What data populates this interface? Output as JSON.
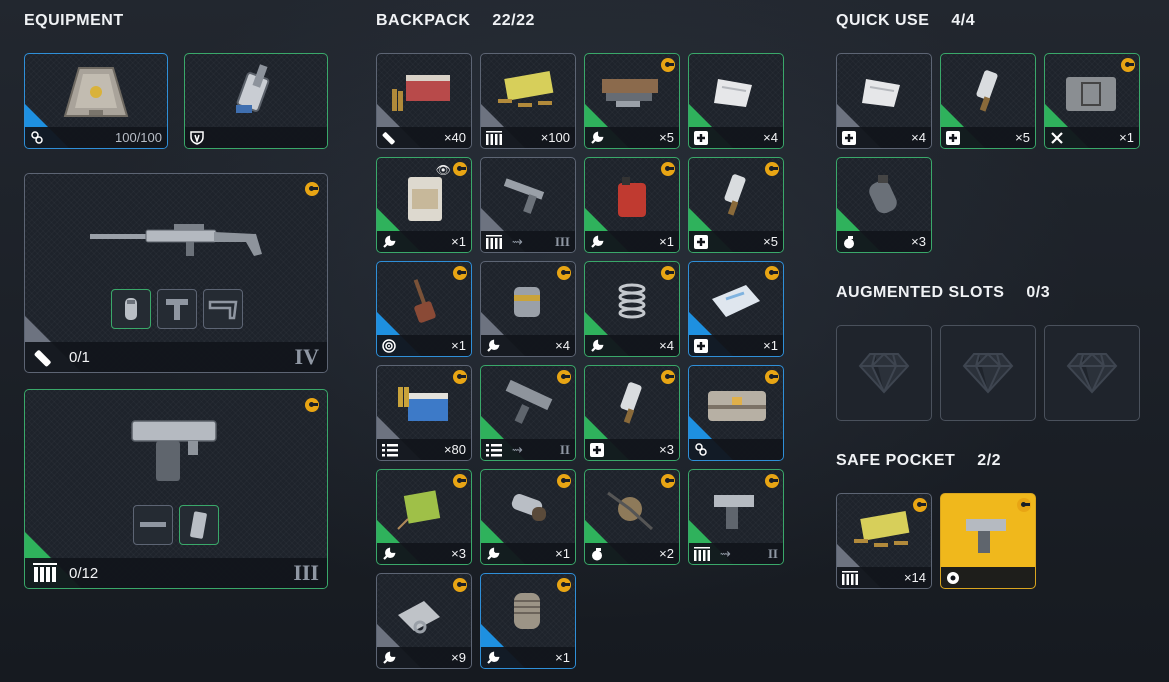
{
  "equipment": {
    "title": "EQUIPMENT",
    "slots": [
      {
        "icon": "backpack-icon",
        "amount": "100/100",
        "rarity": "blue"
      },
      {
        "icon": "shield-gadget-icon",
        "amount": "",
        "rarity": "green"
      }
    ],
    "primary_weapon": {
      "ammo": "0/1",
      "tier": "IV",
      "attachment_icons": [
        "grenade-attachment-icon",
        "stock-attachment-icon",
        "sight-attachment-icon"
      ]
    },
    "sidearm": {
      "ammo": "0/12",
      "tier": "III",
      "attachment_icons": [
        "barrel-attachment-icon",
        "magazine-attachment-icon"
      ]
    }
  },
  "backpack": {
    "title": "BACKPACK",
    "count": "22/22",
    "items": [
      {
        "icon": "heavy-ammo-box-icon",
        "type": "ammo-heavy",
        "qty": "×40",
        "rarity": "grey",
        "coin": false
      },
      {
        "icon": "light-ammo-box-icon",
        "type": "ammo-light",
        "qty": "×100",
        "rarity": "grey",
        "coin": false
      },
      {
        "icon": "scrap-parts-icon",
        "type": "material",
        "qty": "×5",
        "rarity": "green",
        "coin": true
      },
      {
        "icon": "bandage-icon",
        "type": "medical",
        "qty": "×4",
        "rarity": "green",
        "coin": false
      },
      {
        "icon": "fuel-canister-icon",
        "type": "material",
        "qty": "×1",
        "rarity": "green",
        "coin": true
      },
      {
        "icon": "rifle-icon",
        "type": "ammo-light",
        "qty": "",
        "tier": "III",
        "rarity": "grey",
        "coin": false
      },
      {
        "icon": "gas-can-icon",
        "type": "material",
        "qty": "×1",
        "rarity": "green",
        "coin": true
      },
      {
        "icon": "stim-injector-icon",
        "type": "medical",
        "qty": "×5",
        "rarity": "green",
        "coin": true
      },
      {
        "icon": "shovel-icon",
        "type": "target",
        "qty": "×1",
        "rarity": "blue",
        "coin": true
      },
      {
        "icon": "canister-icon",
        "type": "material",
        "qty": "×4",
        "rarity": "grey",
        "coin": true
      },
      {
        "icon": "spring-icon",
        "type": "material",
        "qty": "×4",
        "rarity": "green",
        "coin": true
      },
      {
        "icon": "medkit-bag-icon",
        "type": "medical",
        "qty": "×1",
        "rarity": "blue",
        "coin": true
      },
      {
        "icon": "shotgun-shells-icon",
        "type": "ammo-shotgun",
        "qty": "×80",
        "rarity": "grey",
        "coin": true
      },
      {
        "icon": "smg-icon",
        "type": "ammo-shotgun",
        "qty": "",
        "tier": "II",
        "rarity": "green",
        "coin": true
      },
      {
        "icon": "stim-injector-icon",
        "type": "medical",
        "qty": "×3",
        "rarity": "green",
        "coin": true
      },
      {
        "icon": "crate-backpack-icon",
        "type": "backpack",
        "qty": "",
        "rarity": "blue",
        "coin": true
      },
      {
        "icon": "battery-pack-icon",
        "type": "material",
        "qty": "×3",
        "rarity": "green",
        "coin": true
      },
      {
        "icon": "pipe-part-icon",
        "type": "material",
        "qty": "×1",
        "rarity": "green",
        "coin": true
      },
      {
        "icon": "spike-trap-icon",
        "type": "grenade",
        "qty": "×2",
        "rarity": "green",
        "coin": true
      },
      {
        "icon": "pistol-icon",
        "type": "ammo-light",
        "qty": "",
        "tier": "II",
        "rarity": "green",
        "coin": true
      },
      {
        "icon": "metal-bracket-icon",
        "type": "material",
        "qty": "×9",
        "rarity": "grey",
        "coin": true
      },
      {
        "icon": "motor-part-icon",
        "type": "material",
        "qty": "×1",
        "rarity": "blue",
        "coin": true
      }
    ]
  },
  "quick_use": {
    "title": "QUICK USE",
    "count": "4/4",
    "items": [
      {
        "icon": "bandage-icon",
        "type": "medical",
        "qty": "×4",
        "rarity": "grey"
      },
      {
        "icon": "stim-injector-icon",
        "type": "medical",
        "qty": "×5",
        "rarity": "green"
      },
      {
        "icon": "ammo-crate-icon",
        "type": "tools",
        "qty": "×1",
        "rarity": "green",
        "coin": true
      },
      {
        "icon": "grenade-icon",
        "type": "grenade",
        "qty": "×3",
        "rarity": "green"
      }
    ]
  },
  "augmented_slots": {
    "title": "AUGMENTED SLOTS",
    "count": "0/3"
  },
  "safe_pocket": {
    "title": "SAFE POCKET",
    "count": "2/2",
    "items": [
      {
        "icon": "light-ammo-box-icon",
        "type": "ammo-light",
        "qty": "×14",
        "rarity": "grey",
        "coin": true
      },
      {
        "icon": "pistol-icon",
        "type": "aperture",
        "qty": "",
        "rarity": "gold",
        "coin": true
      }
    ]
  },
  "colors": {
    "grey": "#6d7380",
    "green": "#2fb25c",
    "blue": "#1e90e0",
    "gold": "#e8b41a",
    "coin": "#e8a514"
  }
}
